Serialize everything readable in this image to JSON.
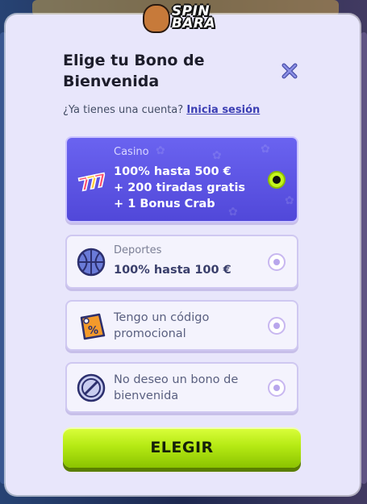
{
  "brand": {
    "logo_text_line1": "SPIN",
    "logo_text_line2": "BARA"
  },
  "modal": {
    "title": "Elige tu Bono de Bienvenida",
    "subtitle_prefix": "¿Ya tienes una cuenta?",
    "login_link": "Inicia sesión",
    "close_icon": "close-icon"
  },
  "options": [
    {
      "id": "casino",
      "label": "Casino",
      "lines": [
        "100% hasta 500 €",
        "+ 200 tiradas gratis",
        "+ 1 Bonus Crab"
      ],
      "icon": "slot-777-icon",
      "selected": true
    },
    {
      "id": "deportes",
      "label": "Deportes",
      "lines": [
        "100% hasta 100 €"
      ],
      "icon": "basketball-icon",
      "selected": false
    },
    {
      "id": "promo",
      "text": "Tengo un código promocional",
      "icon": "promo-tag-icon",
      "selected": false
    },
    {
      "id": "none",
      "text": "No deseo un bono de bienvenida",
      "icon": "no-bonus-icon",
      "selected": false
    }
  ],
  "cta": {
    "label": "ELEGIR"
  },
  "colors": {
    "modal_bg": "#e8e6fb",
    "selected_option": "#5a52e6",
    "cta_green": "#b6ea14",
    "radio_checked": "#c3f51d"
  }
}
